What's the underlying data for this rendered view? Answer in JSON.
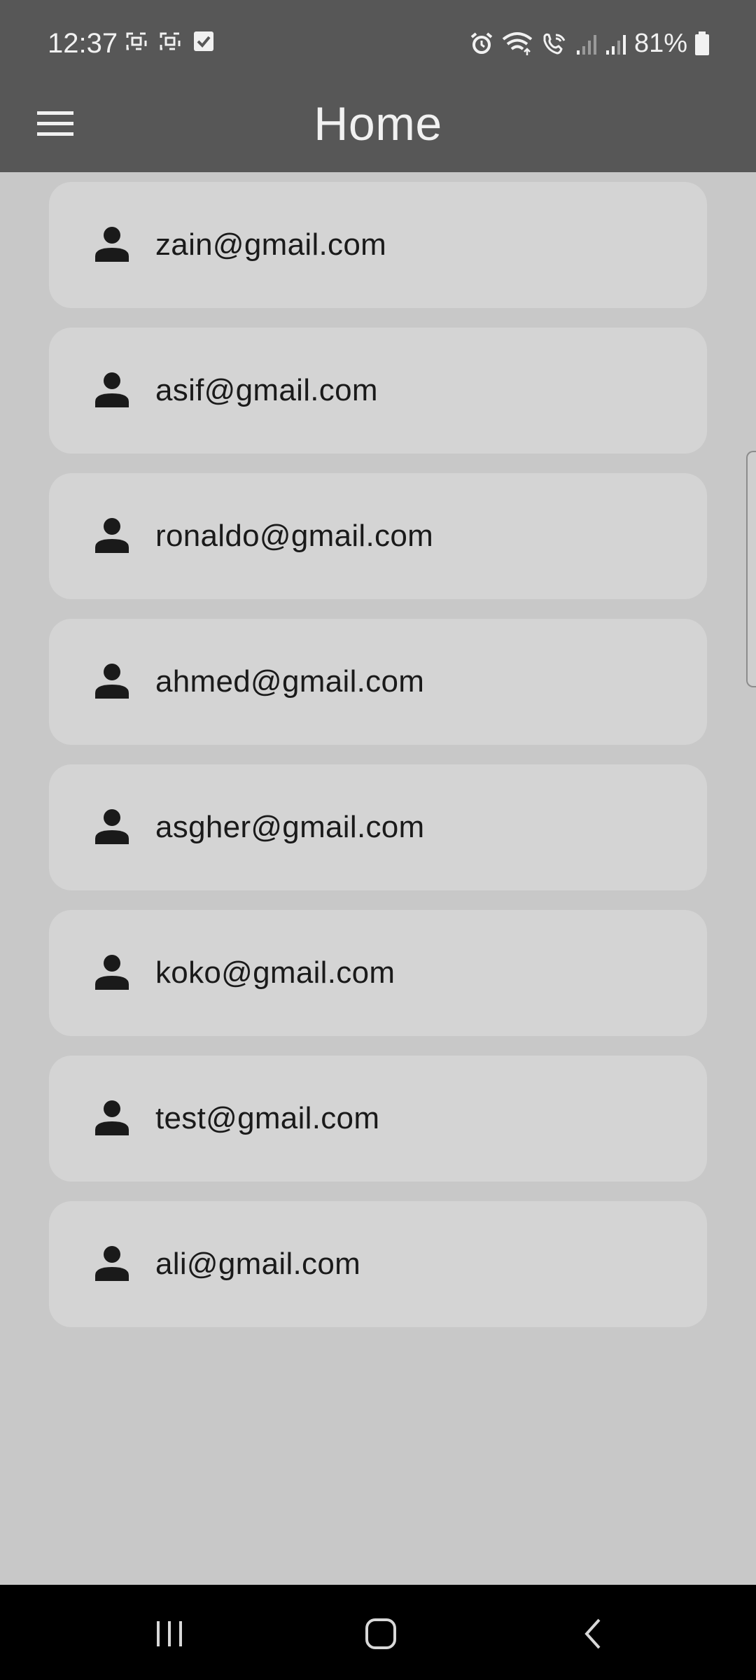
{
  "status_bar": {
    "time": "12:37",
    "battery": "81%"
  },
  "app_bar": {
    "title": "Home",
    "menu_icon": "menu-icon"
  },
  "users": [
    {
      "email": "zain@gmail.com"
    },
    {
      "email": "asif@gmail.com"
    },
    {
      "email": "ronaldo@gmail.com"
    },
    {
      "email": "ahmed@gmail.com"
    },
    {
      "email": "asgher@gmail.com"
    },
    {
      "email": "koko@gmail.com"
    },
    {
      "email": "test@gmail.com"
    },
    {
      "email": "ali@gmail.com"
    }
  ],
  "colors": {
    "app_bar": "#575757",
    "background": "#c8c8c8",
    "card": "#d4d4d4",
    "text": "#1a1a1a"
  }
}
